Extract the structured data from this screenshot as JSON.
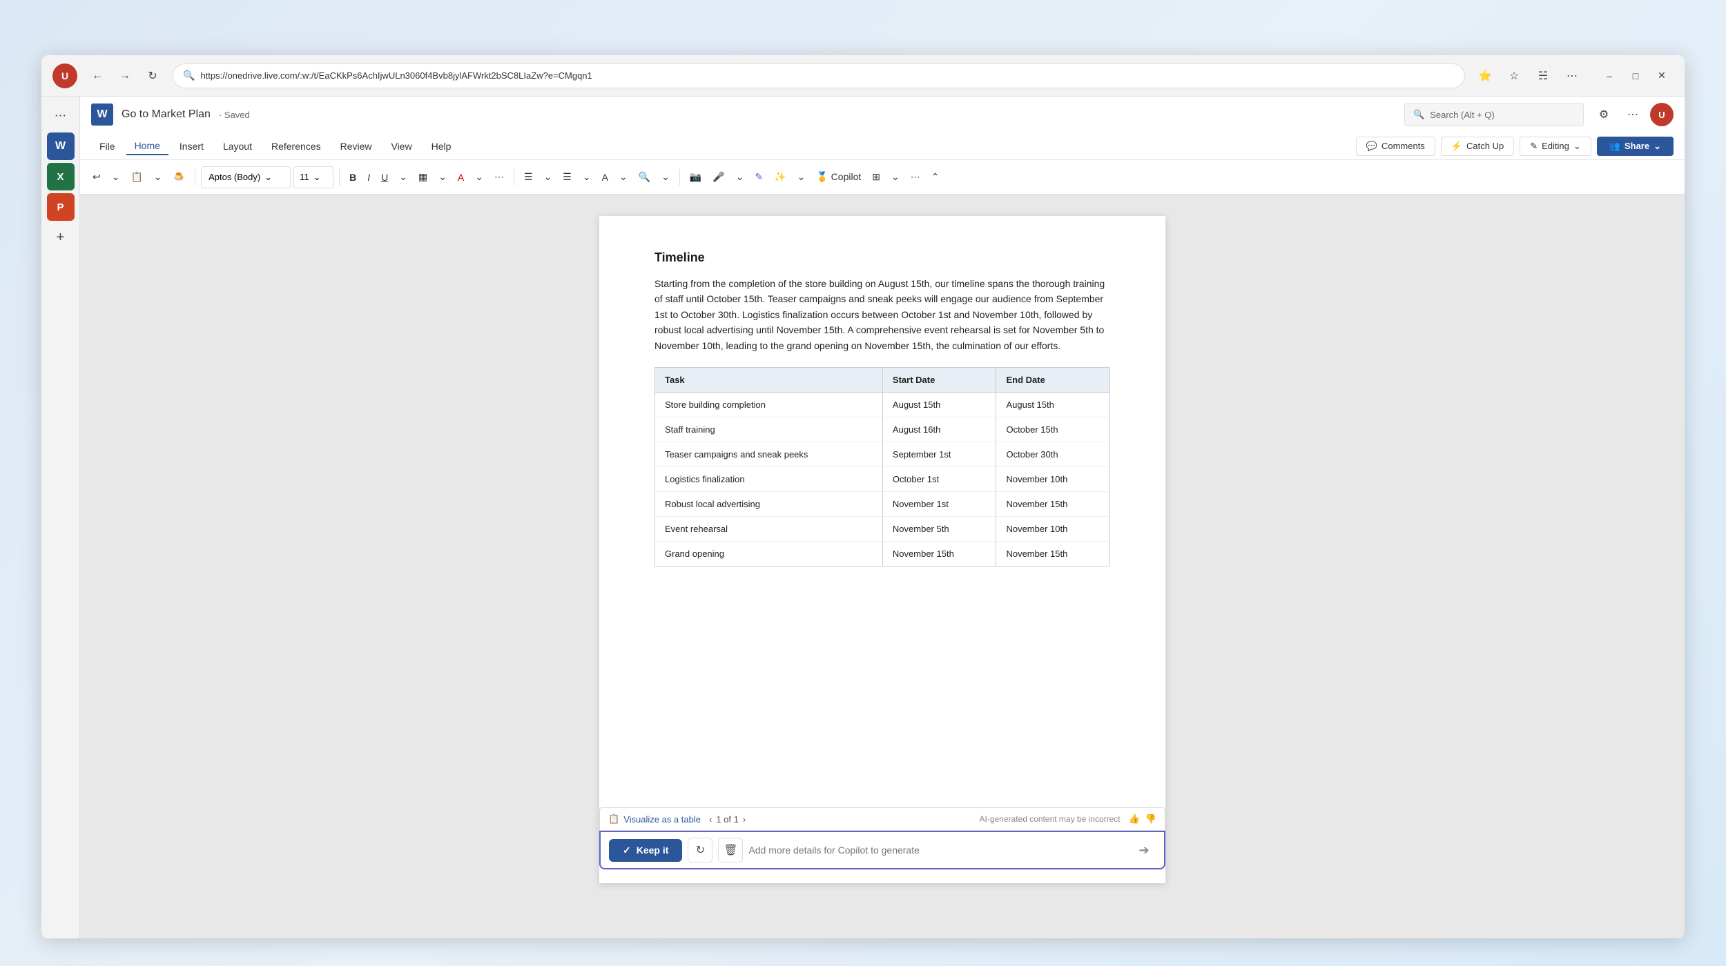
{
  "browser": {
    "url": "https://onedrive.live.com/:w:/t/EaCKkPs6AchIjwULn3060f4Bvb8jylAFWrkt2bSC8LIaZw?e=CMgqn1",
    "avatar_initials": "U"
  },
  "doc": {
    "title": "Go to Market Plan",
    "status": "· Saved",
    "search_placeholder": "Search (Alt + Q)"
  },
  "menu": {
    "file": "File",
    "home": "Home",
    "insert": "Insert",
    "layout": "Layout",
    "references": "References",
    "review": "Review",
    "view": "View",
    "help": "Help"
  },
  "toolbar_right": {
    "comments": "Comments",
    "catchup": "Catch Up",
    "editing": "Editing",
    "share": "Share"
  },
  "formatting": {
    "undo": "↩",
    "font_name": "Aptos (Body)",
    "font_size": "11",
    "bold": "B",
    "italic": "I",
    "underline": "U",
    "more": "···"
  },
  "content": {
    "section_title": "Timeline",
    "paragraph": "Starting from the completion of the store building on August 15th, our timeline spans the thorough training of staff until October 15th. Teaser campaigns and sneak peeks will engage our audience from September 1st to October 30th. Logistics finalization occurs between October 1st and November 10th, followed by robust local advertising until November 15th. A comprehensive event rehearsal is set for November 5th to November 10th, leading to the grand opening on November 15th, the culmination of our efforts.",
    "table": {
      "headers": [
        "Task",
        "Start Date",
        "End Date"
      ],
      "rows": [
        [
          "Store building completion",
          "August 15th",
          "August 15th"
        ],
        [
          "Staff training",
          "August 16th",
          "October 15th"
        ],
        [
          "Teaser campaigns and sneak peeks",
          "September 1st",
          "October 30th"
        ],
        [
          "Logistics finalization",
          "October 1st",
          "November 10th"
        ],
        [
          "Robust local advertising",
          "November 1st",
          "November 15th"
        ],
        [
          "Event rehearsal",
          "November 5th",
          "November 10th"
        ],
        [
          "Grand opening",
          "November 15th",
          "November 15th"
        ]
      ]
    }
  },
  "copilot_bar": {
    "visualize_label": "Visualize as a table",
    "page_indicator": "1 of 1",
    "ai_notice": "AI-generated content may be incorrect",
    "keep_btn": "Keep it",
    "input_placeholder": "Add more details for Copilot to generate",
    "send_icon": "→"
  }
}
